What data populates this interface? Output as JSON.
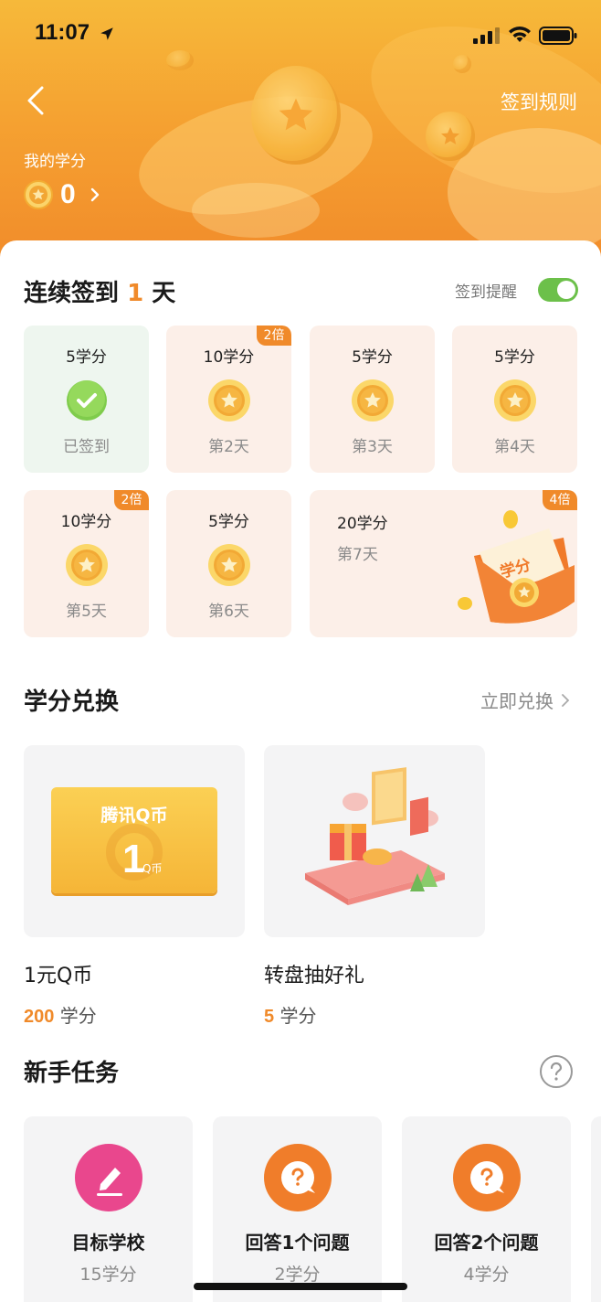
{
  "status_bar": {
    "time": "11:07"
  },
  "header": {
    "rules_link": "签到规则",
    "my_credits_label": "我的学分",
    "credits_value": "0"
  },
  "streak": {
    "prefix": "连续签到",
    "days": "1",
    "suffix": "天",
    "reminder_label": "签到提醒",
    "reminder_on": true,
    "cards": [
      {
        "points": "5学分",
        "label": "已签到",
        "badge": "",
        "state": "done"
      },
      {
        "points": "10学分",
        "label": "第2天",
        "badge": "2倍",
        "state": "pending"
      },
      {
        "points": "5学分",
        "label": "第3天",
        "badge": "",
        "state": "pending"
      },
      {
        "points": "5学分",
        "label": "第4天",
        "badge": "",
        "state": "pending"
      },
      {
        "points": "10学分",
        "label": "第5天",
        "badge": "2倍",
        "state": "pending"
      },
      {
        "points": "5学分",
        "label": "第6天",
        "badge": "",
        "state": "pending"
      },
      {
        "points": "20学分",
        "label": "第7天",
        "badge": "4倍",
        "state": "pending"
      }
    ],
    "redpacket_text": "学分"
  },
  "exchange": {
    "title": "学分兑换",
    "action": "立即兑换",
    "items": [
      {
        "name": "1元Q币",
        "cost_num": "200",
        "cost_unit": "学分",
        "card_title": "腾讯Q币",
        "card_num": "1",
        "card_unit": "Q币"
      },
      {
        "name": "转盘抽好礼",
        "cost_num": "5",
        "cost_unit": "学分"
      }
    ]
  },
  "tasks": {
    "title": "新手任务",
    "items": [
      {
        "name": "目标学校",
        "points": "15学分",
        "icon": "pencil-icon",
        "color": "#e9478d"
      },
      {
        "name": "回答1个问题",
        "points": "2学分",
        "icon": "question-icon",
        "color": "#f07d2a"
      },
      {
        "name": "回答2个问题",
        "points": "4学分",
        "icon": "question-icon",
        "color": "#f07d2a"
      }
    ]
  },
  "colors": {
    "accent": "#f08a2a",
    "toggle_on": "#6cc04a",
    "card_bg": "#fcefe8",
    "done_bg": "#eef6ef"
  }
}
